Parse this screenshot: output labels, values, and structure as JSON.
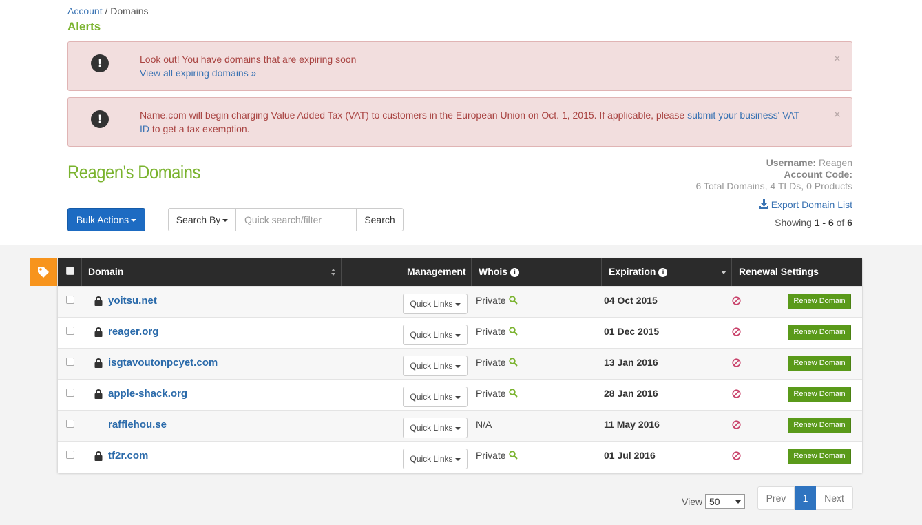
{
  "breadcrumb": {
    "root": "Account",
    "separator": " / ",
    "current": "Domains"
  },
  "alerts_title": "Alerts",
  "alerts": [
    {
      "text": "Look out! You have domains that are expiring soon",
      "link": "View all expiring domains »",
      "text_after": ""
    },
    {
      "text": "Name.com will begin charging Value Added Tax (VAT) to customers in the European Union on Oct. 1, 2015. If applicable, please ",
      "link": "submit your business' VAT ID",
      "text_after": " to get a tax exemption."
    }
  ],
  "close_glyph": "×",
  "page_title": "Reagen's Domains",
  "account": {
    "username_label": "Username:",
    "username": "Reagen",
    "code_label": "Account Code:",
    "summary": "6 Total Domains, 4 TLDs, 0 Products"
  },
  "export_label": "Export Domain List",
  "showing": {
    "prefix": "Showing ",
    "range": "1 - 6",
    "of": " of ",
    "total": "6"
  },
  "toolbar": {
    "bulk_actions": "Bulk Actions",
    "search_by": "Search By",
    "search_placeholder": "Quick search/filter",
    "search_button": "Search"
  },
  "table": {
    "headers": {
      "domain": "Domain",
      "management": "Management",
      "whois": "Whois",
      "expiration": "Expiration",
      "renewal": "Renewal Settings"
    },
    "quick_links_label": "Quick Links",
    "renew_label": "Renew Domain",
    "rows": [
      {
        "domain": "yoitsu.net",
        "locked": true,
        "whois": "Private",
        "whois_search": true,
        "expiration": "04 Oct 2015"
      },
      {
        "domain": "reager.org",
        "locked": true,
        "whois": "Private",
        "whois_search": true,
        "expiration": "01 Dec 2015"
      },
      {
        "domain": "isgtavoutonpcyet.com",
        "locked": true,
        "whois": "Private",
        "whois_search": true,
        "expiration": "13 Jan 2016"
      },
      {
        "domain": "apple-shack.org",
        "locked": true,
        "whois": "Private",
        "whois_search": true,
        "expiration": "28 Jan 2016"
      },
      {
        "domain": "rafflehou.se",
        "locked": false,
        "whois": "N/A",
        "whois_search": false,
        "expiration": "11 May 2016"
      },
      {
        "domain": "tf2r.com",
        "locked": true,
        "whois": "Private",
        "whois_search": true,
        "expiration": "01 Jul 2016"
      }
    ]
  },
  "pagination": {
    "view_label": "View",
    "page_size": "50",
    "prev": "Prev",
    "current": "1",
    "next": "Next"
  },
  "colors": {
    "accent_green": "#7ab32e",
    "link_blue": "#2a6aaa",
    "primary_button": "#1d6bc2",
    "tag_orange": "#f7941d",
    "renew_green": "#5a9a1a",
    "alert_bg": "#f2dede"
  }
}
